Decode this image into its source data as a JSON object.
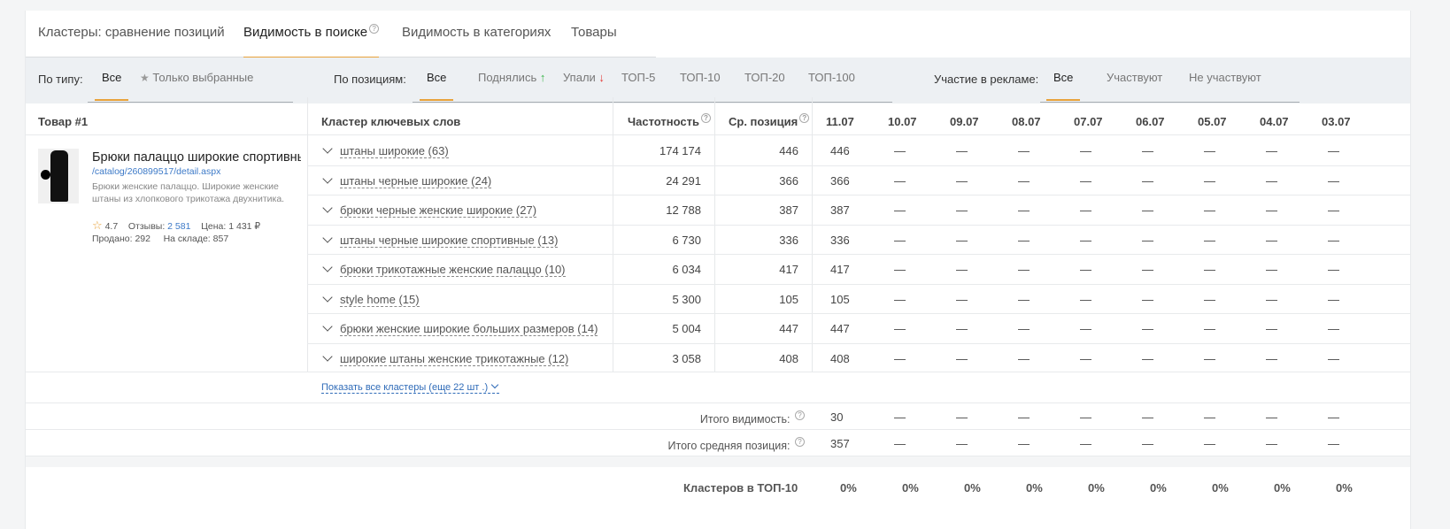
{
  "tabs": [
    {
      "label": "Кластеры: сравнение позиций"
    },
    {
      "label": "Видимость в поиске",
      "help": "?"
    },
    {
      "label": "Видимость в категориях"
    },
    {
      "label": "Товары"
    }
  ],
  "filters": {
    "type_label": "По типу:",
    "type_all": "Все",
    "type_selected": "Только выбранные",
    "pos_label": "По позициям:",
    "pos_all": "Все",
    "pos_up": "Поднялись",
    "pos_down": "Упали",
    "top5": "ТОП-5",
    "top10": "ТОП-10",
    "top20": "ТОП-20",
    "top100": "ТОП-100",
    "ads_label": "Участие в рекламе:",
    "ads_all": "Все",
    "ads_in": "Участвуют",
    "ads_out": "Не участвуют"
  },
  "table": {
    "headers": {
      "product": "Товар #1",
      "cluster": "Кластер ключевых слов",
      "frequency": "Частотность",
      "avg_position": "Ср. позиция",
      "help": "?"
    },
    "dates": [
      "11.07",
      "10.07",
      "09.07",
      "08.07",
      "07.07",
      "06.07",
      "05.07",
      "04.07",
      "03.07"
    ],
    "rows": [
      {
        "cluster": "штаны широкие (63)",
        "frequency": "174 174",
        "avg": "446",
        "d0": "446",
        "rest": "—"
      },
      {
        "cluster": "штаны черные широкие (24)",
        "frequency": "24 291",
        "avg": "366",
        "d0": "366",
        "rest": "—"
      },
      {
        "cluster": "брюки черные женские широкие (27)",
        "frequency": "12 788",
        "avg": "387",
        "d0": "387",
        "rest": "—"
      },
      {
        "cluster": "штаны черные широкие спортивные (13)",
        "frequency": "6 730",
        "avg": "336",
        "d0": "336",
        "rest": "—"
      },
      {
        "cluster": "брюки трикотажные женские палаццо (10)",
        "frequency": "6 034",
        "avg": "417",
        "d0": "417",
        "rest": "—"
      },
      {
        "cluster": "style home (15)",
        "frequency": "5 300",
        "avg": "105",
        "d0": "105",
        "rest": "—"
      },
      {
        "cluster": "брюки женские широкие больших размеров (14)",
        "frequency": "5 004",
        "avg": "447",
        "d0": "447",
        "rest": "—"
      },
      {
        "cluster": "широкие штаны женские трикотажные (12)",
        "frequency": "3 058",
        "avg": "408",
        "d0": "408",
        "rest": "—"
      }
    ],
    "show_all": "Показать все кластеры (еще 22 шт .)",
    "totals": [
      {
        "label": "Итого видимость:",
        "d0": "30",
        "rest": "—"
      },
      {
        "label": "Итого средняя позиция:",
        "d0": "357",
        "rest": "—"
      }
    ],
    "top10_label": "Кластеров в ТОП-10",
    "top10_values": [
      "0%",
      "0%",
      "0%",
      "0%",
      "0%",
      "0%",
      "0%",
      "0%",
      "0%"
    ]
  },
  "product": {
    "title": "Брюки палаццо широкие спортивные",
    "link": "/catalog/260899517/detail.aspx",
    "description": "Брюки женские палаццо. Широкие женские штаны из хлопкового трикотажа двухнитика.",
    "rating": "4.7",
    "reviews_label": "Отзывы:",
    "reviews": "2 581",
    "price_label": "Цена:",
    "price": "1 431 ₽",
    "sold_label": "Продано:",
    "sold": "292",
    "stock_label": "На складе:",
    "stock": "857"
  },
  "colors": {
    "accent": "#e8a23a",
    "link": "#3d7ac8",
    "up": "#3bb54a",
    "down": "#e53935"
  }
}
